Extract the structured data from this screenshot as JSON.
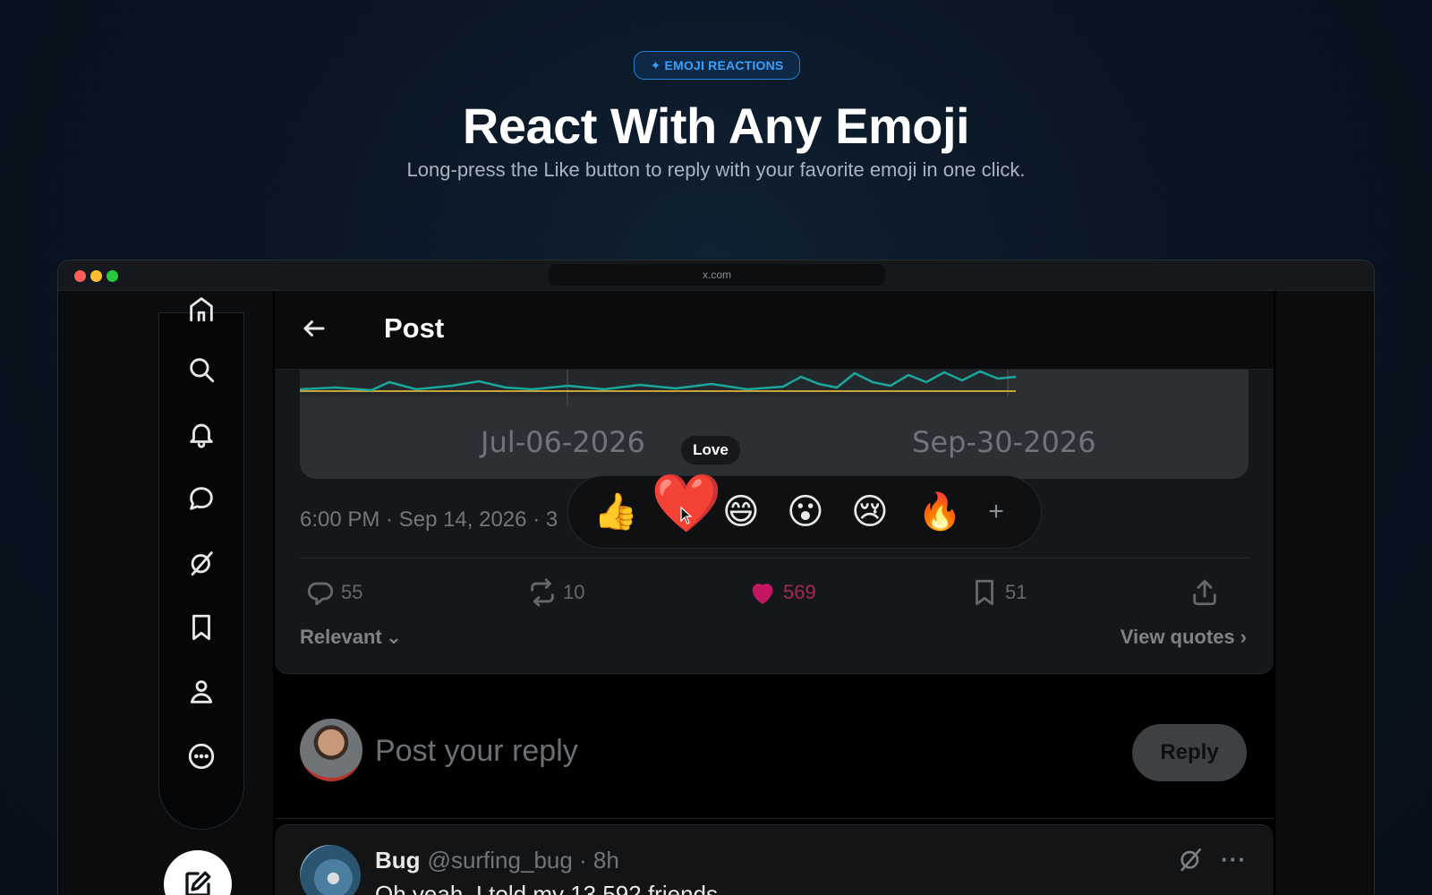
{
  "hero": {
    "badge_icon": "✦",
    "badge": "EMOJI REACTIONS",
    "title": "React With Any Emoji",
    "subtitle": "Long-press the Like button to reply with your favorite emoji in one click."
  },
  "browser": {
    "url": "x.com"
  },
  "header": {
    "title": "Post"
  },
  "post": {
    "chart_ticks": [
      "Jul-06-2026",
      "Sep-30-2026"
    ],
    "timestamp": "6:00 PM · Sep 14, 2026 · 3",
    "stats": {
      "replies": "55",
      "reposts": "10",
      "likes": "569",
      "bookmarks": "51"
    },
    "sort_label": "Relevant",
    "view_quotes": "View quotes"
  },
  "reactions": {
    "tooltip": "Love",
    "emojis": [
      "👍",
      "❤️",
      "😄",
      "😮",
      "😢",
      "🔥"
    ],
    "add": "+"
  },
  "composer": {
    "placeholder": "Post your reply",
    "button": "Reply"
  },
  "reply": {
    "name": "Bug",
    "handle": "@surfing_bug · 8h",
    "text": "Oh yeah, I told my 13,592 friends"
  },
  "colors": {
    "accent": "#1d9bf0",
    "like": "#c21660",
    "badge": "#3aa0ff"
  }
}
